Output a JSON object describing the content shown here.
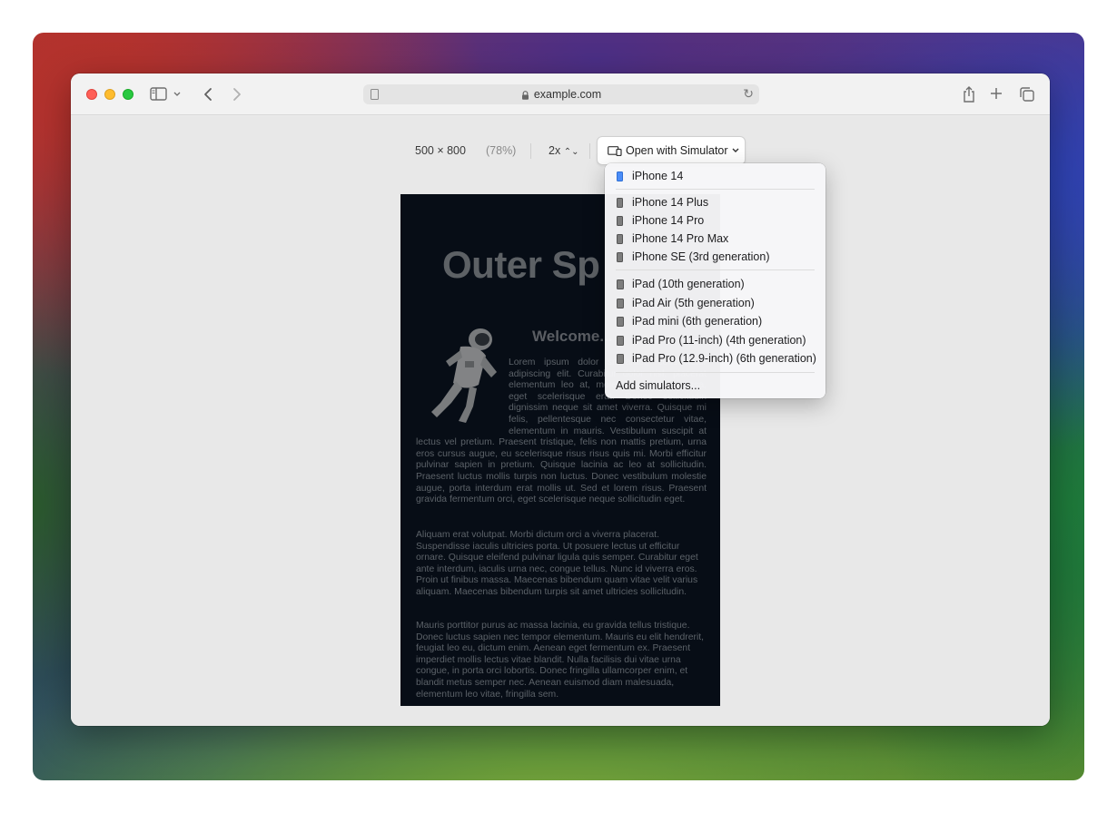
{
  "browser": {
    "address": "example.com"
  },
  "rdm": {
    "size": "500 × 800",
    "zoom_percent": "(78%)",
    "scale": "2x",
    "open_with_label": "Open with Simulator"
  },
  "page": {
    "title": "Outer Sp",
    "welcome": "Welcome...",
    "para1": "Lorem ipsum dolor sit amet, consectetur adipiscing elit. Curabitur dolor nisl, placerat elementum leo at, molestie eleifend massa, eget scelerisque erat. Donec sollicitudin dignissim neque sit amet viverra. Quisque mi felis, pellentesque nec consectetur vitae, elementum in mauris. Vestibulum suscipit at lectus vel pretium. Praesent tristique, felis non mattis pretium, urna eros cursus augue, eu scelerisque risus risus quis mi. Morbi efficitur pulvinar sapien in pretium. Quisque lacinia ac leo at sollicitudin. Praesent luctus mollis turpis non luctus. Donec vestibulum molestie augue, porta interdum erat mollis ut. Sed et lorem risus. Praesent gravida fermentum orci, eget scelerisque neque sollicitudin eget.",
    "para2": "Aliquam erat volutpat. Morbi dictum orci a viverra placerat. Suspendisse iaculis ultricies porta. Ut posuere lectus ut efficitur ornare. Quisque eleifend pulvinar ligula quis semper. Curabitur eget ante interdum, iaculis urna nec, congue tellus. Nunc id viverra eros. Proin ut finibus massa. Maecenas bibendum quam vitae velit varius aliquam. Maecenas bibendum turpis sit amet ultricies sollicitudin.",
    "para3": "Mauris porttitor purus ac massa lacinia, eu gravida tellus tristique. Donec luctus sapien nec tempor elementum. Mauris eu elit hendrerit, feugiat leo eu, dictum enim. Aenean eget fermentum ex. Praesent imperdiet mollis lectus vitae blandit. Nulla facilisis dui vitae urna congue, in porta orci lobortis. Donec fringilla ullamcorper enim, et blandit metus semper nec. Aenean euismod diam malesuada, elementum leo vitae, fringilla sem."
  },
  "menu": {
    "items": [
      {
        "label": "iPhone 14",
        "icon": "iphone-icon",
        "selected": true
      },
      {
        "label": "iPhone 14 Plus",
        "icon": "iphone-icon"
      },
      {
        "label": "iPhone 14 Pro",
        "icon": "iphone-icon"
      },
      {
        "label": "iPhone 14 Pro Max",
        "icon": "iphone-icon"
      },
      {
        "label": "iPhone SE (3rd generation)",
        "icon": "iphone-icon"
      },
      {
        "label": "iPad (10th generation)",
        "icon": "ipad-icon"
      },
      {
        "label": "iPad Air (5th generation)",
        "icon": "ipad-icon"
      },
      {
        "label": "iPad mini (6th generation)",
        "icon": "ipad-icon"
      },
      {
        "label": "iPad Pro (11-inch) (4th generation)",
        "icon": "ipad-icon"
      },
      {
        "label": "iPad Pro (12.9-inch) (6th generation)",
        "icon": "ipad-icon"
      }
    ],
    "add_label": "Add simulators..."
  }
}
